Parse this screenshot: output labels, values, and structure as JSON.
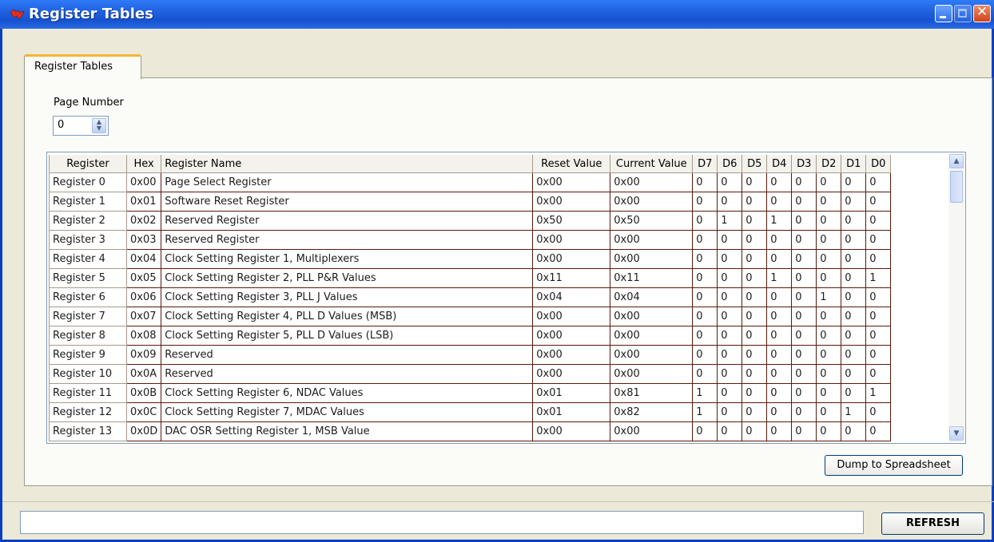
{
  "window": {
    "title": "Register Tables",
    "accent": "#2061e0",
    "close_symbol": "✕"
  },
  "tab": {
    "label": "Register Tables"
  },
  "page_number": {
    "label": "Page Number",
    "value": "0"
  },
  "table": {
    "columns": [
      "Register",
      "Hex",
      "Register Name",
      "Reset Value",
      "Current Value",
      "D7",
      "D6",
      "D5",
      "D4",
      "D3",
      "D2",
      "D1",
      "D0"
    ],
    "rows": [
      [
        "Register 0",
        "0x00",
        "Page Select Register",
        "0x00",
        "0x00",
        "0",
        "0",
        "0",
        "0",
        "0",
        "0",
        "0",
        "0"
      ],
      [
        "Register 1",
        "0x01",
        "Software Reset Register",
        "0x00",
        "0x00",
        "0",
        "0",
        "0",
        "0",
        "0",
        "0",
        "0",
        "0"
      ],
      [
        "Register 2",
        "0x02",
        "Reserved Register",
        "0x50",
        "0x50",
        "0",
        "1",
        "0",
        "1",
        "0",
        "0",
        "0",
        "0"
      ],
      [
        "Register 3",
        "0x03",
        "Reserved Register",
        "0x00",
        "0x00",
        "0",
        "0",
        "0",
        "0",
        "0",
        "0",
        "0",
        "0"
      ],
      [
        "Register 4",
        "0x04",
        "Clock Setting Register 1, Multiplexers",
        "0x00",
        "0x00",
        "0",
        "0",
        "0",
        "0",
        "0",
        "0",
        "0",
        "0"
      ],
      [
        "Register 5",
        "0x05",
        "Clock Setting Register 2, PLL P&R Values",
        "0x11",
        "0x11",
        "0",
        "0",
        "0",
        "1",
        "0",
        "0",
        "0",
        "1"
      ],
      [
        "Register 6",
        "0x06",
        "Clock Setting Register 3, PLL J Values",
        "0x04",
        "0x04",
        "0",
        "0",
        "0",
        "0",
        "0",
        "1",
        "0",
        "0"
      ],
      [
        "Register 7",
        "0x07",
        "Clock Setting Register 4, PLL D Values (MSB)",
        "0x00",
        "0x00",
        "0",
        "0",
        "0",
        "0",
        "0",
        "0",
        "0",
        "0"
      ],
      [
        "Register 8",
        "0x08",
        "Clock Setting Register 5, PLL D Values (LSB)",
        "0x00",
        "0x00",
        "0",
        "0",
        "0",
        "0",
        "0",
        "0",
        "0",
        "0"
      ],
      [
        "Register 9",
        "0x09",
        "Reserved",
        "0x00",
        "0x00",
        "0",
        "0",
        "0",
        "0",
        "0",
        "0",
        "0",
        "0"
      ],
      [
        "Register 10",
        "0x0A",
        "Reserved",
        "0x00",
        "0x00",
        "0",
        "0",
        "0",
        "0",
        "0",
        "0",
        "0",
        "0"
      ],
      [
        "Register 11",
        "0x0B",
        "Clock Setting Register 6, NDAC Values",
        "0x01",
        "0x81",
        "1",
        "0",
        "0",
        "0",
        "0",
        "0",
        "0",
        "1"
      ],
      [
        "Register 12",
        "0x0C",
        "Clock Setting Register 7, MDAC Values",
        "0x01",
        "0x82",
        "1",
        "0",
        "0",
        "0",
        "0",
        "0",
        "1",
        "0"
      ],
      [
        "Register 13",
        "0x0D",
        "DAC OSR Setting Register 1, MSB Value",
        "0x00",
        "0x00",
        "0",
        "0",
        "0",
        "0",
        "0",
        "0",
        "0",
        "0"
      ]
    ]
  },
  "buttons": {
    "dump": "Dump to Spreadsheet",
    "refresh": "REFRESH"
  },
  "status": {
    "value": ""
  }
}
